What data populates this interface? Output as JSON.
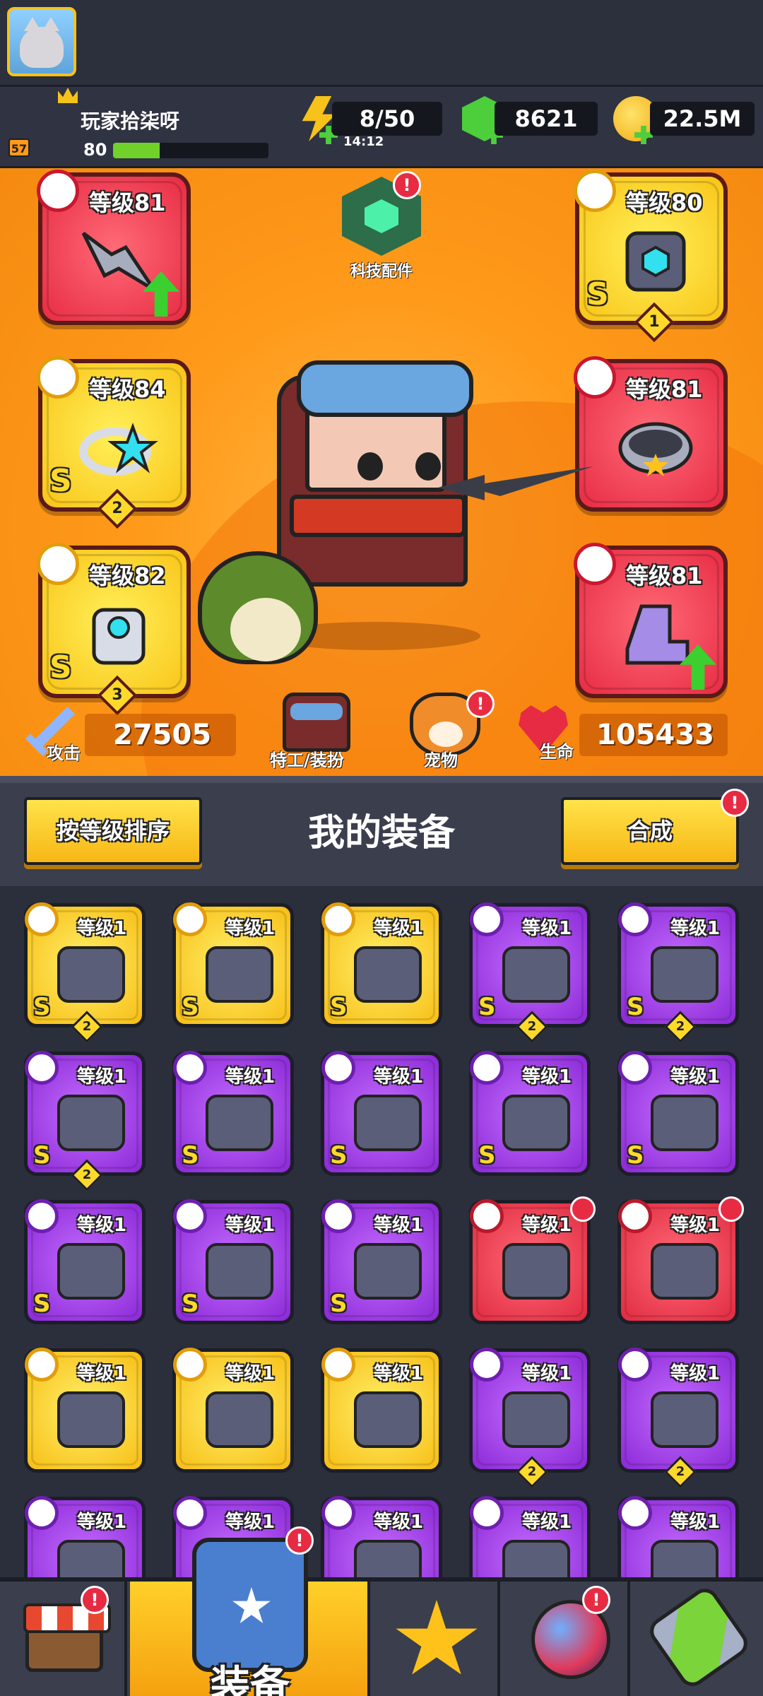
{
  "header": {
    "player_name": "玩家拾柒呀",
    "player_level": "80",
    "avatar_badge": "57",
    "xp_progress": 0.3,
    "energy": "8/50",
    "energy_timer": "14:12",
    "gems": "8621",
    "coins": "22.5M"
  },
  "hero": {
    "tech_parts_label": "科技配件",
    "slots": [
      {
        "level": "等级81",
        "color": "red",
        "stars": "",
        "rank": "",
        "upgrade": true
      },
      {
        "level": "等级80",
        "color": "yellow",
        "stars": "1",
        "rank": "S",
        "upgrade": false
      },
      {
        "level": "等级84",
        "color": "yellow",
        "stars": "2",
        "rank": "S",
        "upgrade": false
      },
      {
        "level": "等级81",
        "color": "red",
        "stars": "",
        "rank": "",
        "upgrade": false
      },
      {
        "level": "等级82",
        "color": "yellow",
        "stars": "3",
        "rank": "S",
        "upgrade": false
      },
      {
        "level": "等级81",
        "color": "red",
        "stars": "",
        "rank": "",
        "upgrade": true
      }
    ],
    "attack_label": "攻击",
    "attack_value": "27505",
    "agent_label": "特工/装扮",
    "pet_label": "宠物",
    "hp_label": "生命",
    "hp_value": "105433",
    "alert_mark": "!"
  },
  "equipment": {
    "sort_button": "按等级排序",
    "title": "我的装备",
    "merge_button": "合成",
    "items": [
      {
        "level": "等级1",
        "color": "yellow",
        "rank": "S",
        "stars": "2"
      },
      {
        "level": "等级1",
        "color": "yellow",
        "rank": "S",
        "stars": ""
      },
      {
        "level": "等级1",
        "color": "yellow",
        "rank": "S",
        "stars": ""
      },
      {
        "level": "等级1",
        "color": "purple",
        "rank": "S",
        "stars": "2"
      },
      {
        "level": "等级1",
        "color": "purple",
        "rank": "S",
        "stars": "2"
      },
      {
        "level": "等级1",
        "color": "purple",
        "rank": "S",
        "stars": "2"
      },
      {
        "level": "等级1",
        "color": "purple",
        "rank": "S",
        "stars": ""
      },
      {
        "level": "等级1",
        "color": "purple",
        "rank": "S",
        "stars": ""
      },
      {
        "level": "等级1",
        "color": "purple",
        "rank": "S",
        "stars": ""
      },
      {
        "level": "等级1",
        "color": "purple",
        "rank": "S",
        "stars": ""
      },
      {
        "level": "等级1",
        "color": "purple",
        "rank": "S",
        "stars": ""
      },
      {
        "level": "等级1",
        "color": "purple",
        "rank": "S",
        "stars": ""
      },
      {
        "level": "等级1",
        "color": "purple",
        "rank": "S",
        "stars": ""
      },
      {
        "level": "等级1",
        "color": "red",
        "rank": "",
        "stars": "",
        "badge": true
      },
      {
        "level": "等级1",
        "color": "red",
        "rank": "",
        "stars": "",
        "badge": true
      },
      {
        "level": "等级1",
        "color": "yellow",
        "rank": "",
        "stars": ""
      },
      {
        "level": "等级1",
        "color": "yellow",
        "rank": "",
        "stars": ""
      },
      {
        "level": "等级1",
        "color": "yellow",
        "rank": "",
        "stars": ""
      },
      {
        "level": "等级1",
        "color": "purple",
        "rank": "",
        "stars": "2"
      },
      {
        "level": "等级1",
        "color": "purple",
        "rank": "",
        "stars": "2"
      },
      {
        "level": "等级1",
        "color": "purple",
        "rank": "",
        "stars": ""
      },
      {
        "level": "等级1",
        "color": "purple",
        "rank": "",
        "stars": ""
      },
      {
        "level": "等级1",
        "color": "purple",
        "rank": "",
        "stars": ""
      },
      {
        "level": "等级1",
        "color": "purple",
        "rank": "",
        "stars": ""
      },
      {
        "level": "等级1",
        "color": "purple",
        "rank": "",
        "stars": ""
      }
    ]
  },
  "nav": {
    "active_label": "装备",
    "icons": [
      "shop-icon",
      "equipment-icon",
      "star-icon",
      "orb-icon",
      "dna-icon"
    ]
  },
  "colors": {
    "accent_orange": "#ff9a1a",
    "alert_red": "#e72b43",
    "gem_green": "#4ccf3a",
    "gold": "#f7c21a"
  }
}
